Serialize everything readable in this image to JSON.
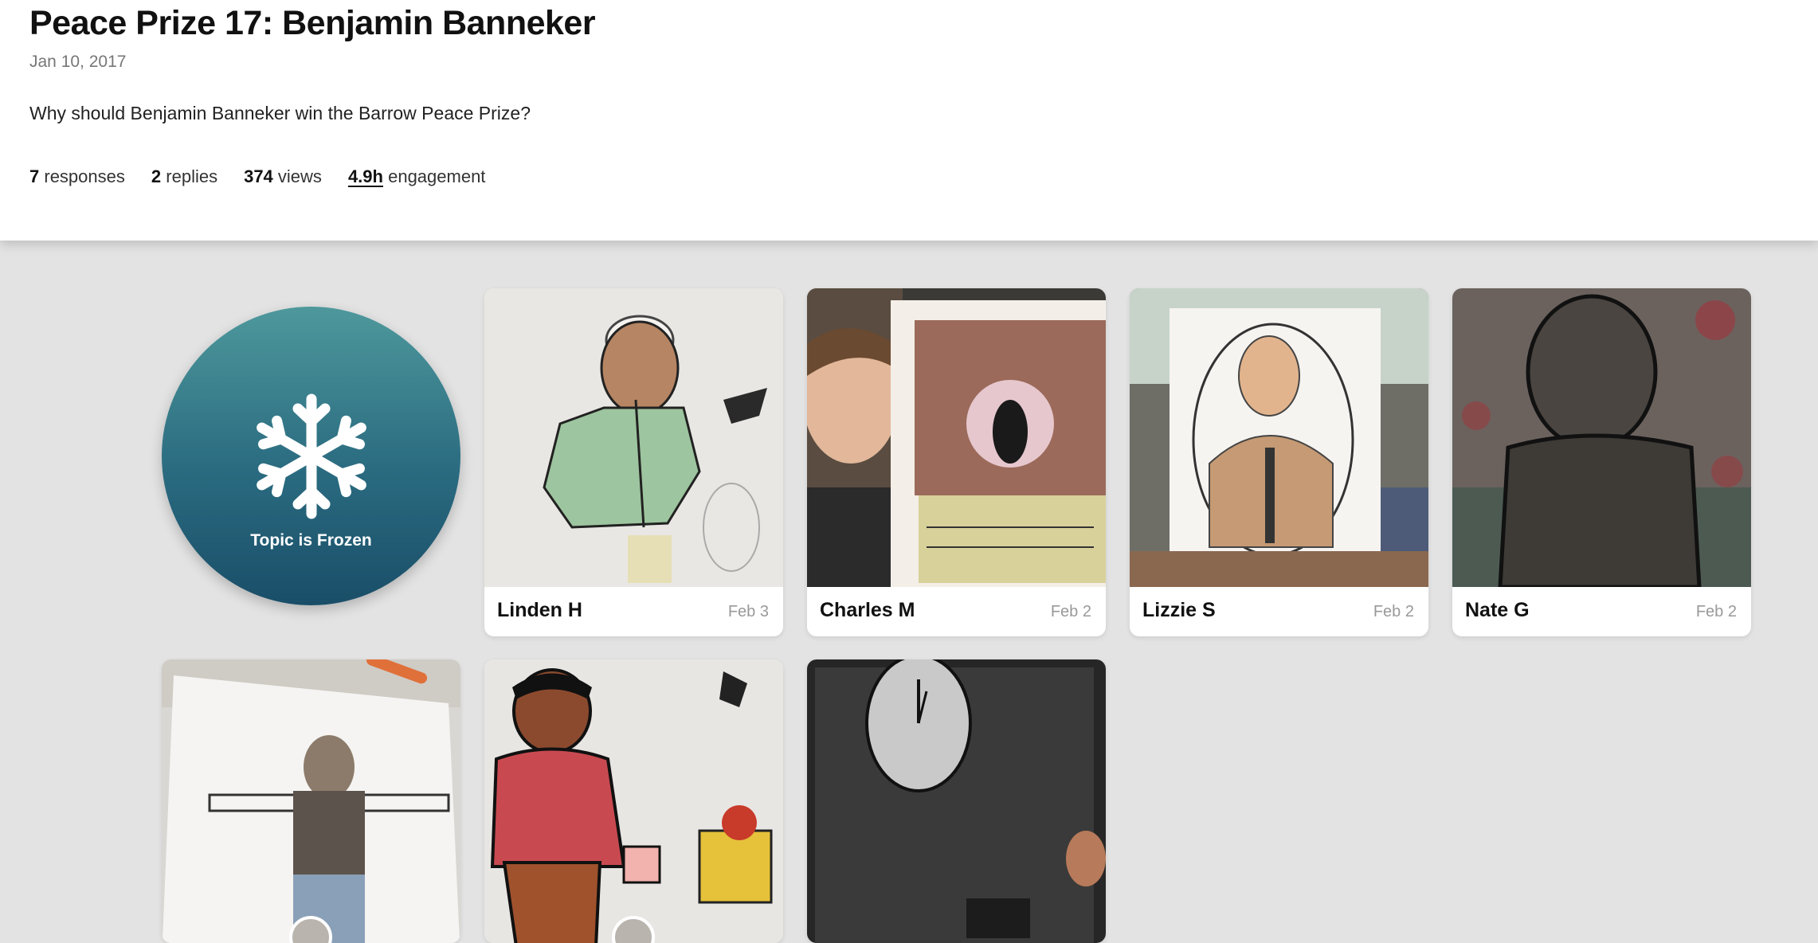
{
  "header": {
    "title": "Peace Prize 17: Benjamin Banneker",
    "date": "Jan 10, 2017",
    "prompt": "Why should Benjamin Banneker win the Barrow Peace Prize?",
    "stats": {
      "responses_count": "7",
      "responses_label": "responses",
      "replies_count": "2",
      "replies_label": "replies",
      "views_count": "374",
      "views_label": "views",
      "engagement_value": "4.9h",
      "engagement_label": "engagement"
    }
  },
  "frozen": {
    "label": "Topic is Frozen",
    "icon": "snowflake-icon"
  },
  "responses": [
    {
      "name": "Linden H",
      "date": "Feb 3"
    },
    {
      "name": "Charles M",
      "date": "Feb 2"
    },
    {
      "name": "Lizzie S",
      "date": "Feb 2"
    },
    {
      "name": "Nate G",
      "date": "Feb 2"
    }
  ],
  "colors": {
    "frozen_top": "#4e989c",
    "frozen_bottom": "#1a4e68",
    "page_bg": "#e3e3e3"
  }
}
